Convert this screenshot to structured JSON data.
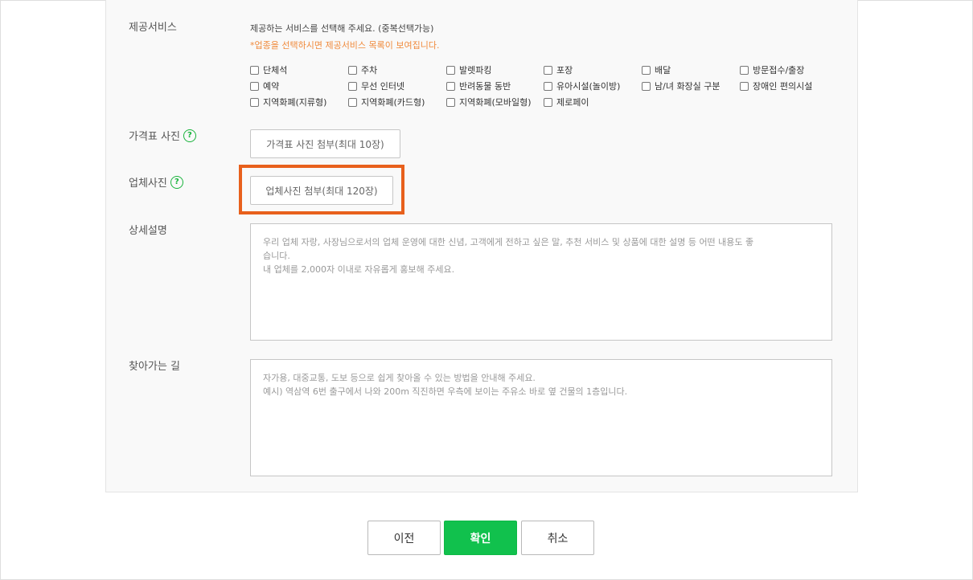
{
  "services": {
    "label": "제공서비스",
    "description": "제공하는 서비스를 선택해 주세요. (중복선택가능)",
    "note": "*업종을 선택하시면 제공서비스 목록이 보여집니다.",
    "options": [
      "단체석",
      "주차",
      "발렛파킹",
      "포장",
      "배달",
      "방문접수/출장",
      "예약",
      "무선 인터넷",
      "반려동물 동반",
      "유아시설(놀이방)",
      "남/녀 화장실 구분",
      "장애인 편의시설",
      "지역화폐(지류형)",
      "지역화폐(카드형)",
      "지역화폐(모바일형)",
      "제로페이"
    ]
  },
  "price_photo": {
    "label": "가격표 사진",
    "button": "가격표 사진 첨부(최대 10장)"
  },
  "business_photo": {
    "label": "업체사진",
    "button": "업체사진 첨부(최대 120장)"
  },
  "detail": {
    "label": "상세설명",
    "placeholder_lines": [
      "우리 업체 자랑, 사장님으로서의 업체 운영에 대한 신념, 고객에게 전하고 싶은 말, 추천 서비스 및 상품에 대한 설명 등 어떤 내용도 좋",
      "습니다.",
      "내 업체를 2,000자 이내로 자유롭게 홍보해 주세요."
    ]
  },
  "directions": {
    "label": "찾아가는 길",
    "placeholder_lines": [
      "자가용, 대중교통, 도보 등으로 쉽게 찾아올 수 있는 방법을 안내해 주세요.",
      "예시) 역삼역 6번 출구에서 나와 200m 직진하면 우측에 보이는 주유소 바로 옆 건물의 1층입니다."
    ]
  },
  "help_icon_name": "question-circle-icon",
  "buttons": {
    "prev": "이전",
    "confirm": "확인",
    "cancel": "취소"
  },
  "colors": {
    "accent": "#11c14d",
    "highlight": "#e8601c",
    "note": "#f08a3c"
  }
}
